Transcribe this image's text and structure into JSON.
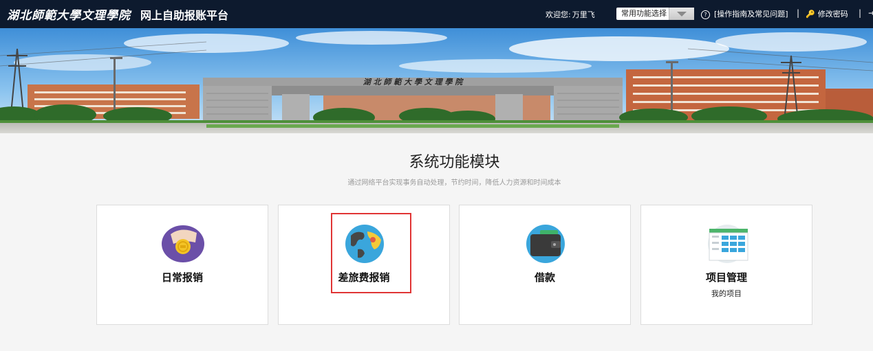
{
  "header": {
    "logo_text": "湖北師範大學文理學院",
    "platform_title": "网上自助报账平台",
    "welcome_label": "欢迎您:",
    "user_name": "万里飞",
    "function_select": {
      "selected": "常用功能选择"
    },
    "help_link": "[操作指南及常见问题]",
    "separator": "|",
    "change_password": "修改密码"
  },
  "banner": {
    "gate_inscription": "湖 北 師 範 大 學 文 理 學 院"
  },
  "section": {
    "title": "系统功能模块",
    "subtitle": "通过网络平台实现事务自动处理，节约时间，降低人力资源和时间成本"
  },
  "modules": [
    {
      "label": "日常报销",
      "icon": "coin-hand-icon"
    },
    {
      "label": "差旅费报销",
      "icon": "globe-icon",
      "highlighted": true
    },
    {
      "label": "借款",
      "icon": "wallet-icon"
    },
    {
      "label": "项目管理",
      "sub_label": "我的项目",
      "icon": "spreadsheet-icon"
    }
  ],
  "colors": {
    "topbar_bg": "#0d1a2e",
    "highlight_border": "#e03434",
    "page_bg": "#f5f5f5"
  }
}
